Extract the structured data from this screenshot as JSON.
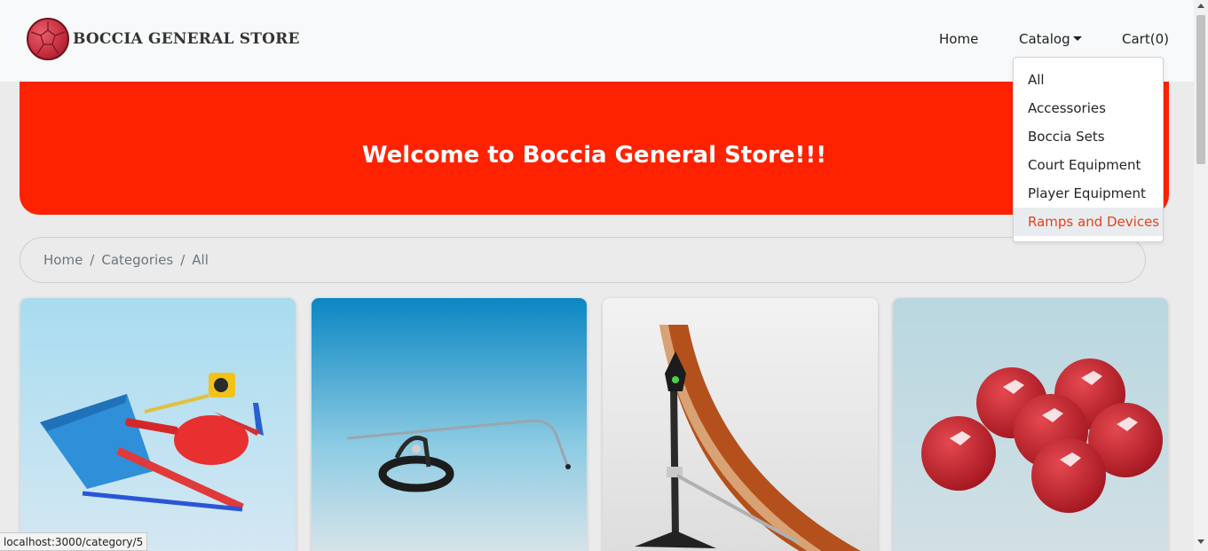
{
  "brand": {
    "name": "BOCCIA GENERAL STORE",
    "logo_icon": "boccia-ball-logo"
  },
  "nav": {
    "home": "Home",
    "catalog": "Catalog",
    "cart": "Cart(0)"
  },
  "catalog_menu": {
    "items": [
      "All",
      "Accessories",
      "Boccia Sets",
      "Court Equipment",
      "Player Equipment",
      "Ramps and Devices"
    ],
    "highlighted": "Ramps and Devices"
  },
  "hero": {
    "title": "Welcome to Boccia General Store!!!"
  },
  "breadcrumb": {
    "items": [
      "Home",
      "Categories",
      "All"
    ],
    "separator": "/"
  },
  "products": [
    {
      "image": "accessories-kit-photo"
    },
    {
      "image": "head-pointer-photo"
    },
    {
      "image": "boccia-ramp-photo"
    },
    {
      "image": "red-boccia-balls-photo"
    }
  ],
  "status_bar": {
    "url": "localhost:3000/category/5"
  },
  "colors": {
    "hero": "#ff2200",
    "highlight_text": "#e8401c",
    "navbar": "#f8f9fa",
    "page": "#ebebeb"
  }
}
